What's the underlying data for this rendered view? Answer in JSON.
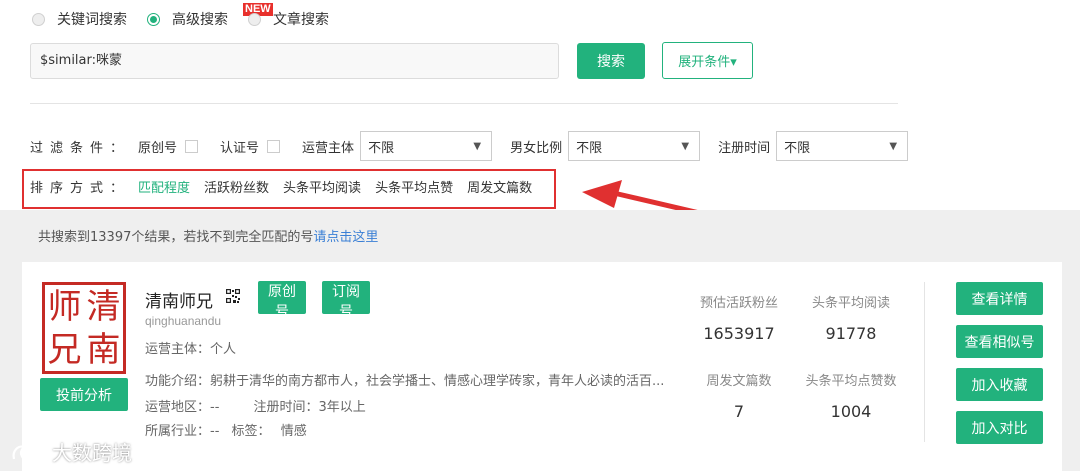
{
  "search_types": {
    "keyword": "关键词搜索",
    "advanced": "高级搜索",
    "advanced_badge": "NEW",
    "article": "文章搜索"
  },
  "search": {
    "query": "$similar:咪蒙",
    "search_button": "搜索",
    "expand_button": "展开条件▾"
  },
  "filters": {
    "label": "过滤条件：",
    "original": "原创号",
    "verified": "认证号",
    "operator_label": "运营主体",
    "operator_value": "不限",
    "gender_label": "男女比例",
    "gender_value": "不限",
    "reg_label": "注册时间",
    "reg_value": "不限"
  },
  "sort": {
    "label": "排序方式：",
    "options": [
      "匹配程度",
      "活跃粉丝数",
      "头条平均阅读",
      "头条平均点赞",
      "周发文篇数"
    ]
  },
  "summary": {
    "text": "共搜索到13397个结果，若找不到完全匹配的号",
    "link": "请点击这里"
  },
  "result": {
    "seal_chars": [
      "师",
      "清",
      "兄",
      "南"
    ],
    "name": "清南师兄",
    "tag_original": "原创号",
    "tag_subscribe": "订阅号",
    "account_id": "qinghuanandu",
    "operator": "运营主体：个人",
    "intro": "功能介绍：躬耕于清华的南方都市人，社会学播士、情感心理学砖家，青年人必读的活百...",
    "region": "运营地区：--",
    "reg_time": "注册时间：3年以上",
    "industry": "所属行业：--",
    "tags_label": "标签：",
    "tags_value": "情感",
    "analysis_button": "投前分析",
    "stats": {
      "fans_label": "预估活跃粉丝",
      "fans_value": "1653917",
      "read_label": "头条平均阅读",
      "read_value": "91778",
      "posts_label": "周发文篇数",
      "posts_value": "7",
      "likes_label": "头条平均点赞数",
      "likes_value": "1004"
    },
    "actions": {
      "detail": "查看详情",
      "similar": "查看相似号",
      "favorite": "加入收藏",
      "compare": "加入对比"
    }
  },
  "watermark": "大数跨境",
  "colors": {
    "accent": "#22b27d",
    "highlight": "#e03030",
    "link": "#3a7fd5"
  }
}
